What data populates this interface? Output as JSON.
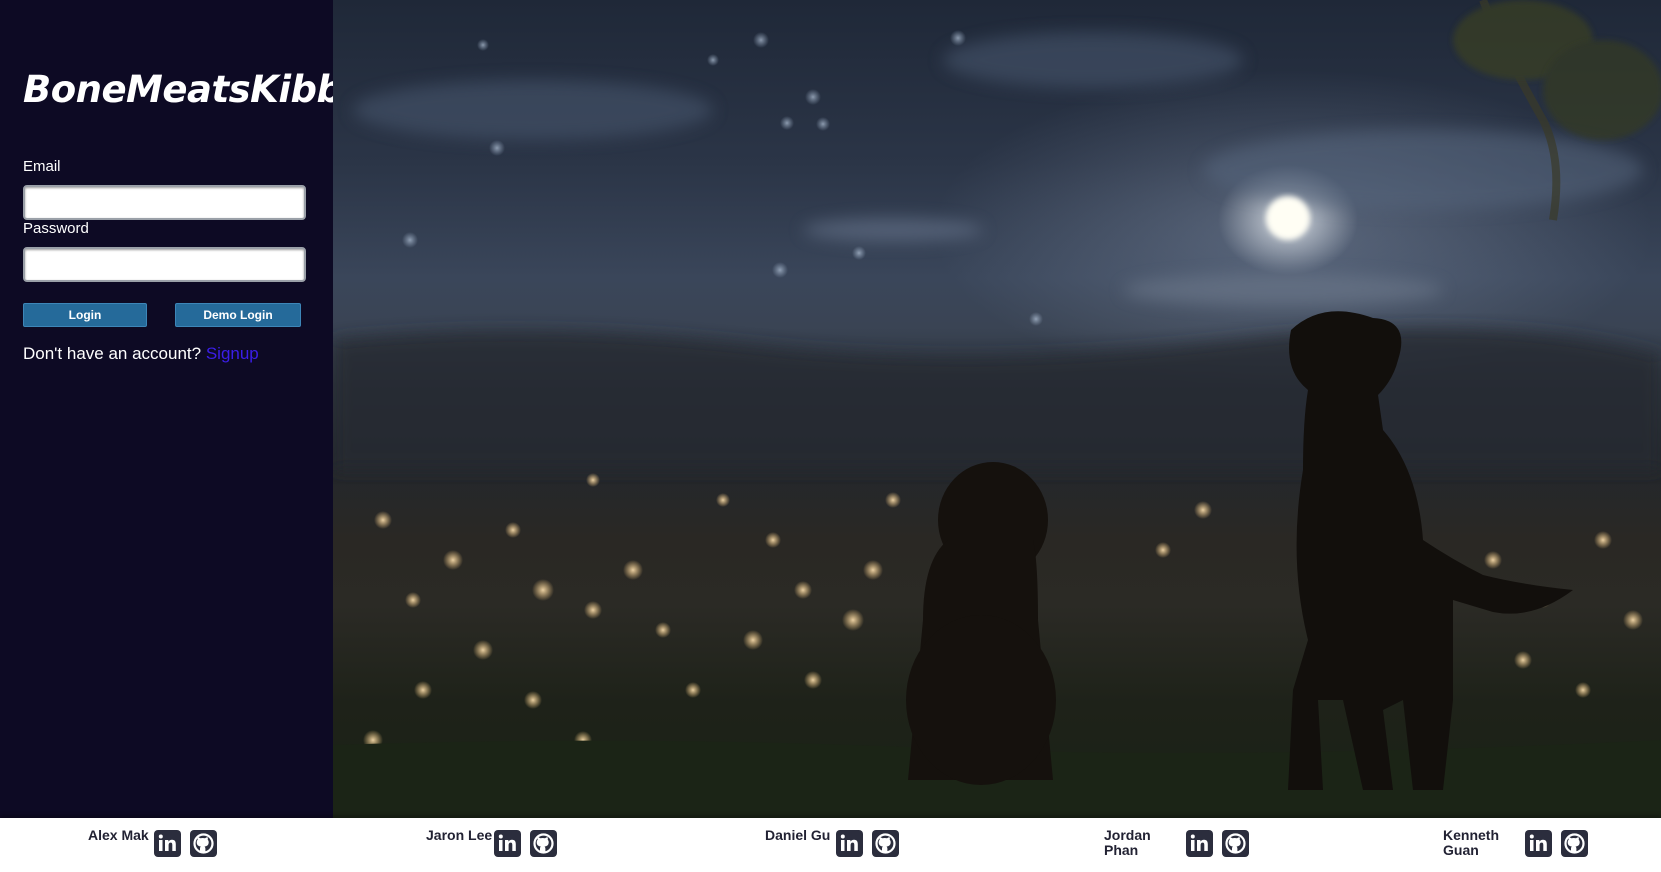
{
  "app": {
    "title": "BoneMeatsKibble"
  },
  "login_form": {
    "email_label": "Email",
    "email_value": "",
    "password_label": "Password",
    "password_value": "",
    "login_button": "Login",
    "demo_login_button": "Demo Login",
    "signup_prompt": "Don't have an account?",
    "signup_link": "Signup"
  },
  "hero": {
    "icon": "night-city-dogs-image"
  },
  "footer": {
    "members": [
      {
        "name_line1": "Alex Mak",
        "name_line2": "",
        "linkedin_icon": "linkedin-icon",
        "github_icon": "github-icon"
      },
      {
        "name_line1": "Jaron Lee",
        "name_line2": "",
        "linkedin_icon": "linkedin-icon",
        "github_icon": "github-icon"
      },
      {
        "name_line1": "Daniel Gu",
        "name_line2": "",
        "linkedin_icon": "linkedin-icon",
        "github_icon": "github-icon"
      },
      {
        "name_line1": "Jordan",
        "name_line2": "Phan",
        "linkedin_icon": "linkedin-icon",
        "github_icon": "github-icon"
      },
      {
        "name_line1": "Kenneth",
        "name_line2": "Guan",
        "linkedin_icon": "linkedin-icon",
        "github_icon": "github-icon"
      }
    ]
  },
  "colors": {
    "sidebar_bg": "#0d0a24",
    "button_bg": "#256a9a",
    "link": "#3b1ee8",
    "icon_bg": "#2b2d3d"
  }
}
